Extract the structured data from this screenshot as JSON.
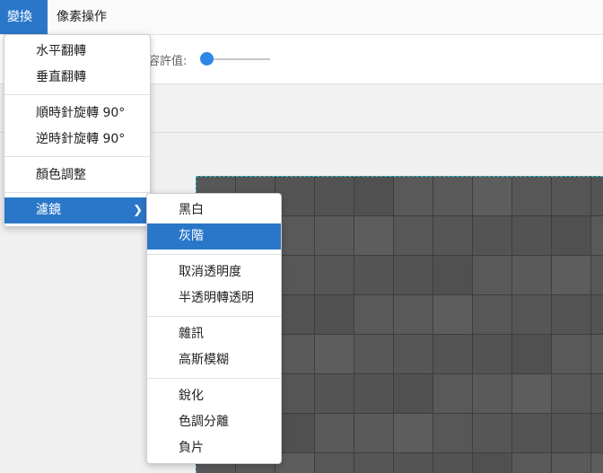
{
  "menubar": {
    "items": [
      {
        "label": "變換",
        "active": true
      },
      {
        "label": "像素操作",
        "active": false
      }
    ]
  },
  "toolbar": {
    "tolerance_label": "容許值:",
    "tolerance_value": 0.05
  },
  "transform_menu": {
    "items": [
      {
        "label": "水平翻轉"
      },
      {
        "label": "垂直翻轉"
      },
      {
        "label": "順時針旋轉 90°"
      },
      {
        "label": "逆時針旋轉 90°"
      },
      {
        "label": "顏色調整"
      },
      {
        "label": "濾鏡",
        "submenu_icon": "chevron-right-icon"
      }
    ]
  },
  "filter_menu": {
    "items": [
      {
        "label": "黑白"
      },
      {
        "label": "灰階"
      },
      {
        "label": "取消透明度"
      },
      {
        "label": "半透明轉透明"
      },
      {
        "label": "雜訊"
      },
      {
        "label": "高斯模糊"
      },
      {
        "label": "銳化"
      },
      {
        "label": "色調分離"
      },
      {
        "label": "負片"
      }
    ]
  },
  "colors": {
    "accent": "#2a77c9",
    "slider": "#2e86e6",
    "selection_border": "#2bc6d6"
  }
}
